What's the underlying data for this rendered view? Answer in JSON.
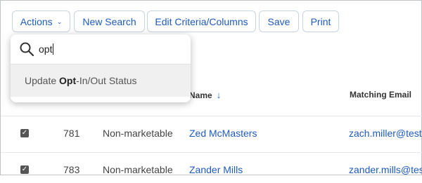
{
  "toolbar": {
    "actions_label": "Actions",
    "new_search_label": "New Search",
    "edit_criteria_label": "Edit Criteria/Columns",
    "save_label": "Save",
    "print_label": "Print"
  },
  "dropdown": {
    "search_value": "opt",
    "option": {
      "prefix": "Update ",
      "match": "Opt",
      "suffix": "-In/Out Status"
    }
  },
  "table": {
    "headers": {
      "name": "Name",
      "email": "Matching Email"
    },
    "sort": "descending",
    "rows": [
      {
        "checked": true,
        "id": "781",
        "status": "Non-marketable",
        "name": "Zed McMasters",
        "email": "zach.miller@test."
      },
      {
        "checked": true,
        "id": "783",
        "status": "Non-marketable",
        "name": "Zander Mills",
        "email": "zander.mills@test"
      }
    ]
  },
  "colors": {
    "accent": "#1f5bbf",
    "highlight": "#f0f0f0"
  },
  "icons": {
    "search": "search-icon",
    "sort": "arrow-down-icon",
    "dropdown": "chevron-down-icon",
    "check": "check-icon"
  }
}
